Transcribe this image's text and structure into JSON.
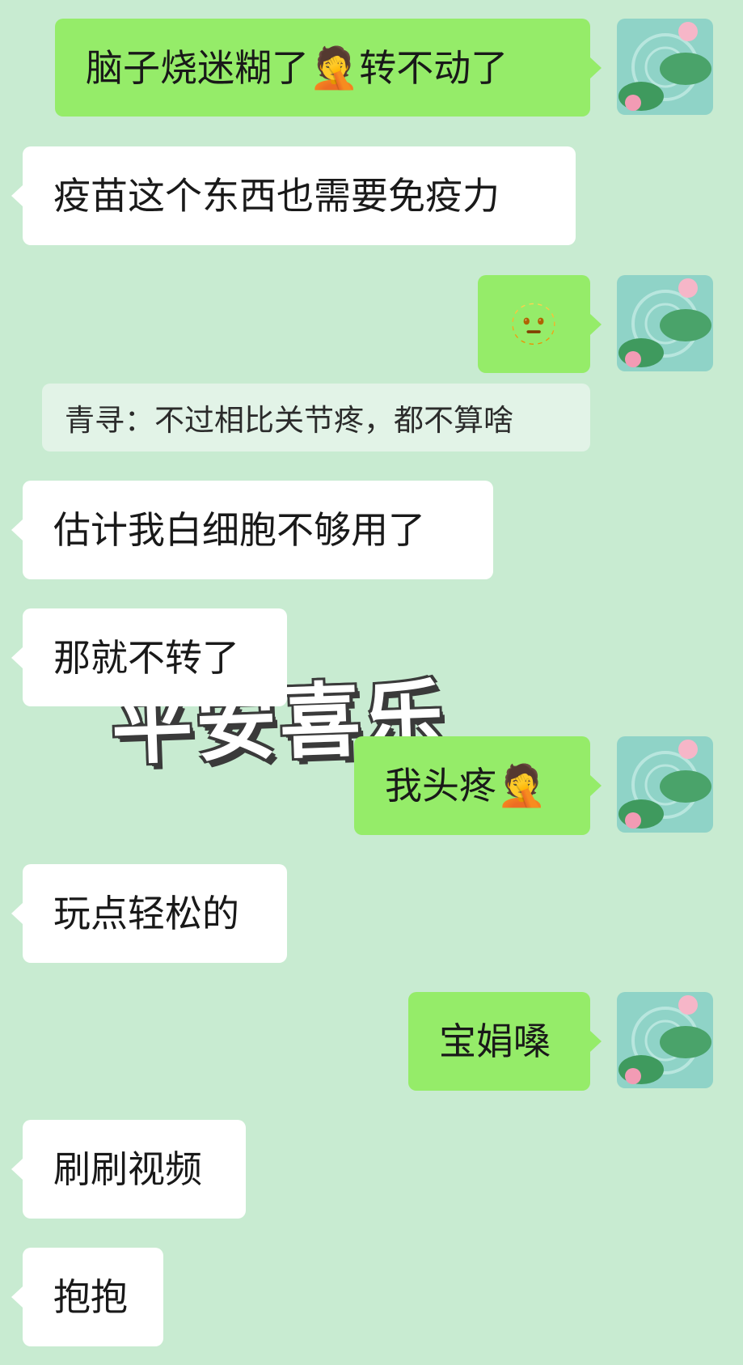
{
  "chat": {
    "msg1": {
      "text_a": "脑子烧迷糊了",
      "emoji": "🤦",
      "text_b": " 转不动了"
    },
    "msg2": {
      "text": "疫苗这个东西也需要免疫力"
    },
    "msg3": {
      "emoji": "🫥"
    },
    "quote": {
      "text": "青寻：不过相比关节疼，都不算啥"
    },
    "msg4": {
      "text": "估计我白细胞不够用了"
    },
    "msg5": {
      "text": "那就不转了"
    },
    "sticker": {
      "text": "平安喜乐"
    },
    "msg6": {
      "text": "我头疼",
      "emoji": "🤦"
    },
    "msg7": {
      "text": "玩点轻松的"
    },
    "msg8": {
      "text": "宝娟嗓"
    },
    "msg9": {
      "text": "刷刷视频"
    },
    "msg10": {
      "text": "抱抱"
    }
  },
  "colors": {
    "background": "#c8ebd1",
    "outgoing_bubble": "#95ec69",
    "incoming_bubble": "#ffffff",
    "quote_bubble": "#e2f3e7"
  },
  "icons": {
    "avatar": "lotus-pond-avatar-icon",
    "emoji_facepalm": "facepalm-emoji-icon",
    "emoji_person": "person-emoji-icon"
  }
}
